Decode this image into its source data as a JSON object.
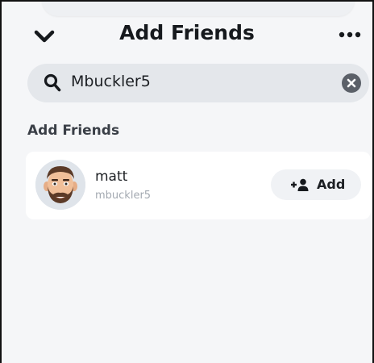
{
  "header": {
    "title": "Add Friends",
    "back_icon": "chevron-down-icon",
    "more_icon": "more-horizontal-icon"
  },
  "search": {
    "value": "Mbuckler5",
    "search_icon": "search-icon",
    "clear_icon": "clear-icon"
  },
  "section": {
    "title": "Add Friends"
  },
  "results": [
    {
      "name": "matt",
      "username": "mbuckler5",
      "avatar_icon": "bitmoji-avatar",
      "add_label": "Add",
      "add_icon": "add-friend-icon"
    }
  ],
  "colors": {
    "background": "#f5f6f8",
    "search_bg": "#e4e7eb",
    "card_bg": "#ffffff",
    "button_bg": "#f0f2f5",
    "text_primary": "#1c1f23",
    "text_secondary": "#a3a9b1"
  }
}
